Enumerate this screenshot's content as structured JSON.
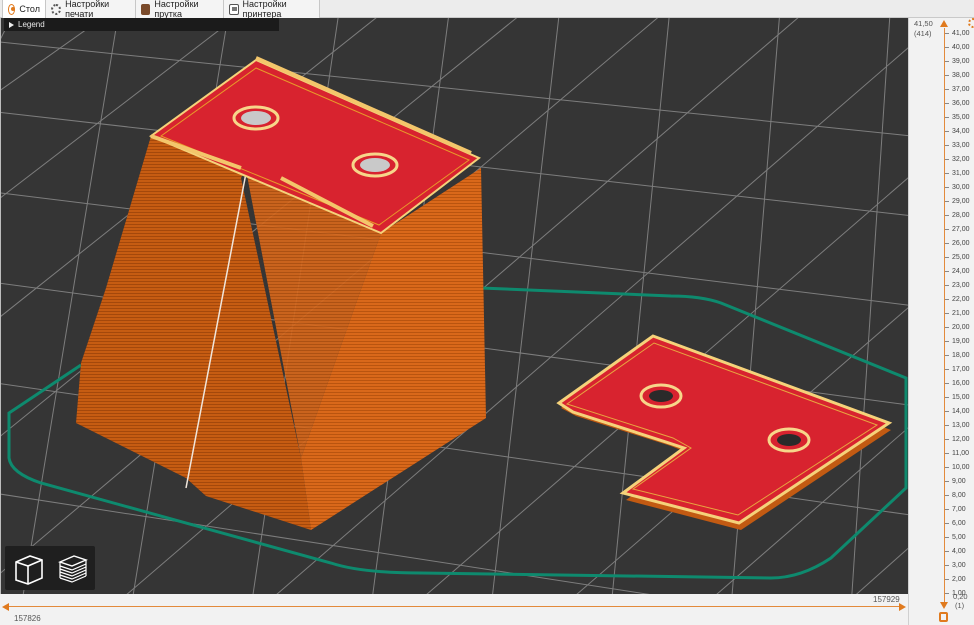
{
  "tabs": [
    {
      "label": "Стол",
      "icon": "plate-icon",
      "active": true
    },
    {
      "label": "Настройки печати",
      "icon": "gear-icon",
      "active": false
    },
    {
      "label": "Настройки прутка",
      "icon": "filament-icon",
      "active": false
    },
    {
      "label": "Настройки принтера",
      "icon": "printer-icon",
      "active": false
    }
  ],
  "legend": {
    "label": "Legend"
  },
  "view_buttons": [
    {
      "name": "iso-view-icon"
    },
    {
      "name": "layers-view-icon"
    }
  ],
  "horizontal_slider": {
    "min_label": "157826",
    "max_label": "157929"
  },
  "vertical_slider": {
    "top_value": "41,50",
    "top_layer": "(414)",
    "bottom_value": "0,20",
    "bottom_layer": "(1)",
    "ticks": [
      "41,00",
      "40,00",
      "39,00",
      "38,00",
      "37,00",
      "36,00",
      "35,00",
      "34,00",
      "33,00",
      "32,00",
      "31,00",
      "30,00",
      "29,00",
      "28,00",
      "27,00",
      "26,00",
      "25,00",
      "24,00",
      "23,00",
      "22,00",
      "21,00",
      "20,00",
      "19,00",
      "18,00",
      "17,00",
      "16,00",
      "15,00",
      "14,00",
      "13,00",
      "12,00",
      "11,00",
      "10,00",
      "9,00",
      "8,00",
      "7,00",
      "6,00",
      "5,00",
      "4,00",
      "3,00",
      "2,00",
      "1,00"
    ]
  },
  "colors": {
    "accent": "#e07a1e",
    "perimeter": "#d9681a",
    "top_infill": "#d8232f",
    "skirt": "#0e8a6e",
    "bed": "#353535",
    "grid": "#8a8a8a"
  }
}
